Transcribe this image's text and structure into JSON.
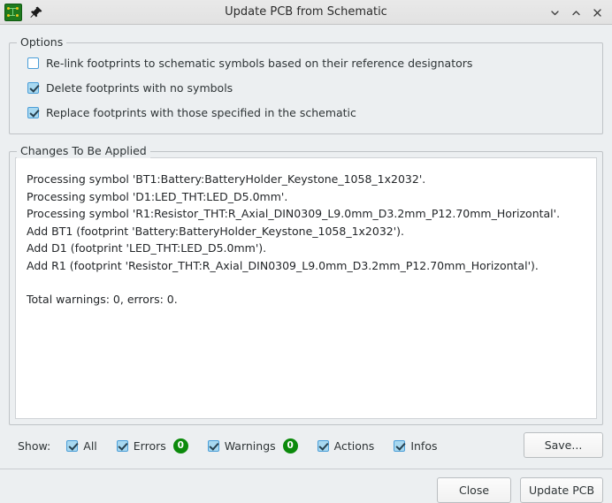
{
  "window": {
    "title": "Update PCB from Schematic",
    "app_icon": "pcb-board-icon",
    "pin_icon": "pin-icon",
    "controls": [
      {
        "name": "minimize-button",
        "glyph": "chevron-down-icon"
      },
      {
        "name": "maximize-button",
        "glyph": "chevron-up-icon"
      },
      {
        "name": "close-window-button",
        "glyph": "close-icon"
      }
    ]
  },
  "options": {
    "legend": "Options",
    "items": [
      {
        "label": "Re-link footprints to schematic symbols based on their reference designators",
        "checked": false
      },
      {
        "label": "Delete footprints with no symbols",
        "checked": true
      },
      {
        "label": "Replace footprints with those specified in the schematic",
        "checked": true
      }
    ]
  },
  "changes": {
    "legend": "Changes To Be Applied",
    "lines": [
      "Processing symbol 'BT1:Battery:BatteryHolder_Keystone_1058_1x2032'.",
      "Processing symbol 'D1:LED_THT:LED_D5.0mm'.",
      "Processing symbol 'R1:Resistor_THT:R_Axial_DIN0309_L9.0mm_D3.2mm_P12.70mm_Horizontal'.",
      "Add BT1 (footprint 'Battery:BatteryHolder_Keystone_1058_1x2032').",
      "Add D1 (footprint 'LED_THT:LED_D5.0mm').",
      "Add R1 (footprint 'Resistor_THT:R_Axial_DIN0309_L9.0mm_D3.2mm_P12.70mm_Horizontal').",
      "",
      "Total warnings: 0, errors: 0."
    ]
  },
  "show": {
    "label": "Show:",
    "filters": [
      {
        "label": "All",
        "checked": true,
        "badge": null
      },
      {
        "label": "Errors",
        "checked": true,
        "badge": "0"
      },
      {
        "label": "Warnings",
        "checked": true,
        "badge": "0"
      },
      {
        "label": "Actions",
        "checked": true,
        "badge": null
      },
      {
        "label": "Infos",
        "checked": true,
        "badge": null
      }
    ],
    "save_label": "Save..."
  },
  "footer": {
    "close_label": "Close",
    "update_label": "Update PCB"
  },
  "colors": {
    "badge_green": "#0b8a0b",
    "checkbox_blue": "#a8d8f0",
    "checkbox_border": "#4a9ed8",
    "window_bg": "#eceff1",
    "panel_bg": "#ffffff",
    "pcb_icon_green": "#1e7a1e"
  }
}
